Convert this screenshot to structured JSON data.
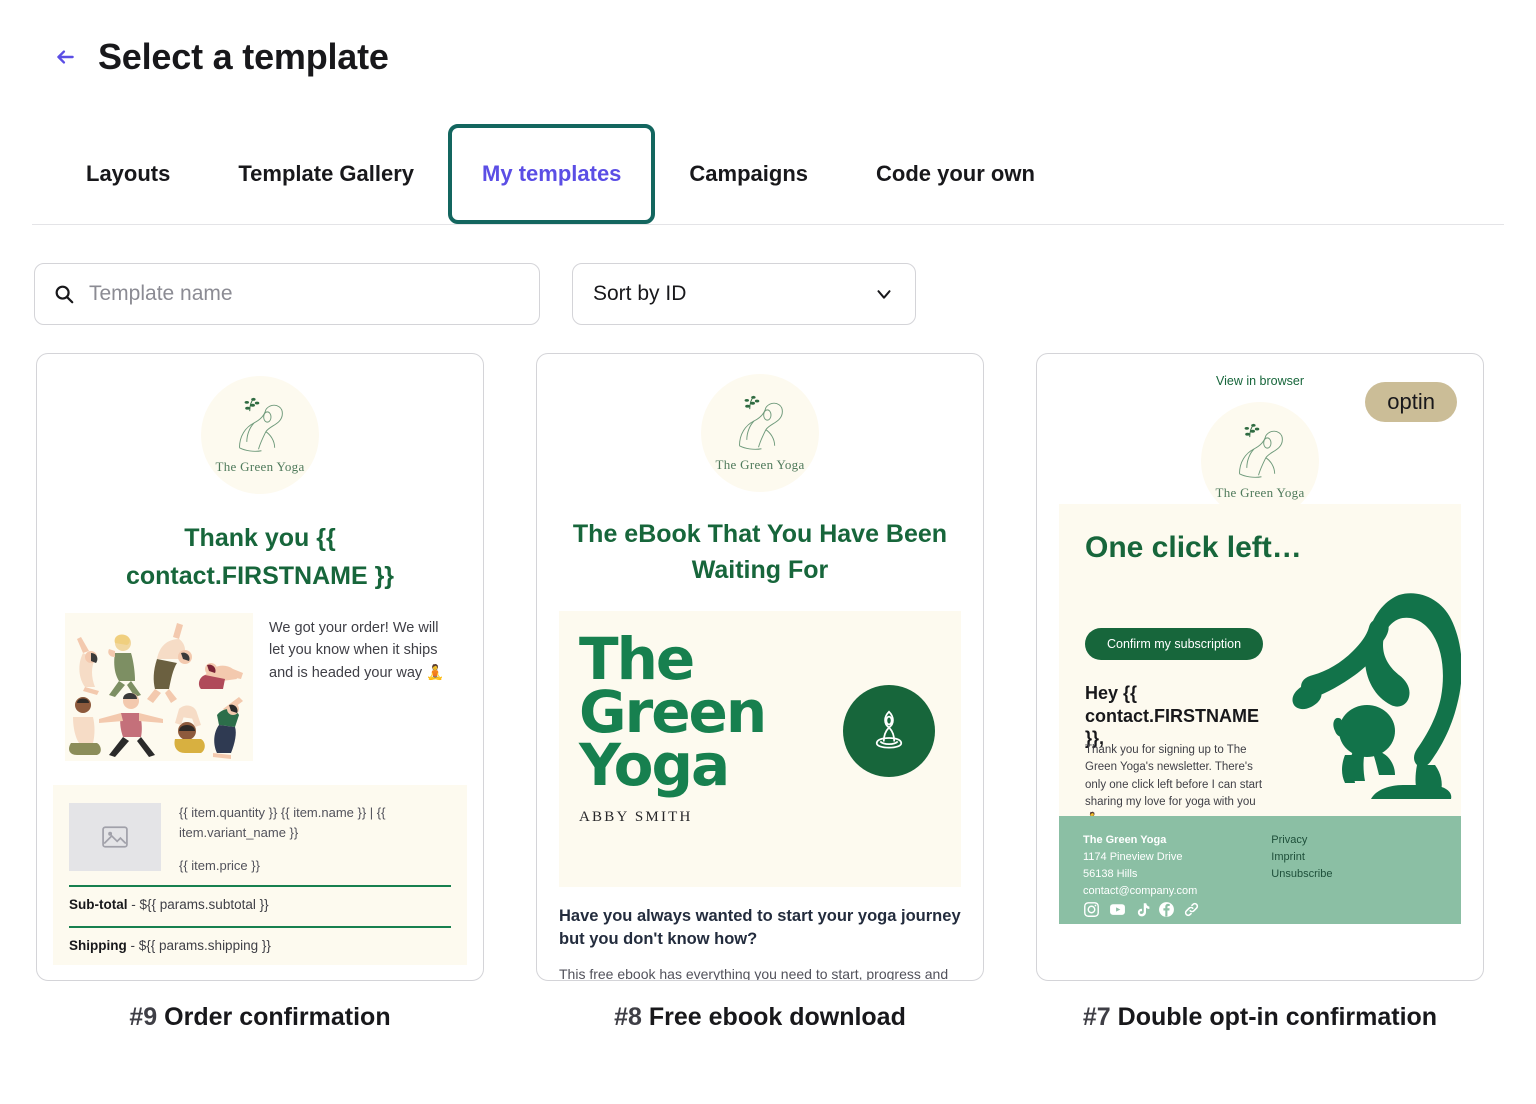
{
  "header": {
    "back_icon": "arrow-left-icon",
    "title": "Select a template"
  },
  "tabs": [
    {
      "label": "Layouts",
      "active": false
    },
    {
      "label": "Template Gallery",
      "active": false
    },
    {
      "label": "My templates",
      "active": true
    },
    {
      "label": "Campaigns",
      "active": false
    },
    {
      "label": "Code your own",
      "active": false
    }
  ],
  "filters": {
    "search_icon": "search-icon",
    "search_placeholder": "Template name",
    "search_value": "",
    "sort_label": "Sort by ID",
    "sort_icon": "chevron-down-icon"
  },
  "colors": {
    "accent_purple": "#5b4ee5",
    "tab_outline_teal": "#13665f",
    "brand_green": "#17663b",
    "brand_green_light": "#17804f",
    "cream": "#fdfaef",
    "footer_green": "#8bbfa4",
    "optin_tan": "#cbbd97"
  },
  "brand": {
    "logo_name": "The Green Yoga"
  },
  "cards": [
    {
      "caption_number": "#9",
      "caption_title": "Order confirmation",
      "heading": "Thank you {{ contact.FIRSTNAME }}",
      "body_text": "We got your order! We will let you know when it ships and is headed your way 🧘",
      "item_line": "{{ item.quantity }} {{ item.name }} | {{ item.variant_name }}",
      "item_price": "{{ item.price }}",
      "subtotal_label": "Sub-total",
      "subtotal_value": "- ${{ params.subtotal }}",
      "shipping_label": "Shipping",
      "shipping_value": "- ${{ params.shipping }}",
      "thumb_icon": "image-placeholder-icon",
      "illustration": "yoga-people-illustration"
    },
    {
      "caption_number": "#8",
      "caption_title": "Free ebook download",
      "heading": "The eBook That You Have Been Waiting For",
      "hero_title_line1": "The",
      "hero_title_line2": "Green",
      "hero_title_line3": "Yoga",
      "hero_author": "ABBY SMITH",
      "hero_badge_icon": "meditating-person-icon",
      "subheading": "Have you always wanted to start your yoga journey but you don't know how?",
      "paragraph": "This free ebook has everything you need to start, progress and refine your yoga practice. With detailed, step-by-step guidance, tips and tricks you'll be"
    },
    {
      "caption_number": "#7",
      "caption_title": "Double opt-in confirmation",
      "view_in_browser": "View in browser",
      "badge": "optin",
      "hero_title": "One click left…",
      "cta_label": "Confirm my subscription",
      "greeting": "Hey {{ contact.FIRSTNAME }},",
      "paragraph": "Thank you for signing up to The Green Yoga's newsletter. There's only one click left before I can start sharing my love for yoga with you 🧘",
      "figure_icon": "yoga-scorpion-pose-icon",
      "footer": {
        "company": "The Green Yoga",
        "address_line1": "1174 Pineview Drive",
        "address_line2": "56138 Hills",
        "email": "contact@company.com",
        "links": [
          "Privacy",
          "Imprint",
          "Unsubscribe"
        ],
        "social_icons": [
          "instagram-icon",
          "youtube-icon",
          "tiktok-icon",
          "facebook-icon",
          "link-icon"
        ]
      }
    }
  ]
}
